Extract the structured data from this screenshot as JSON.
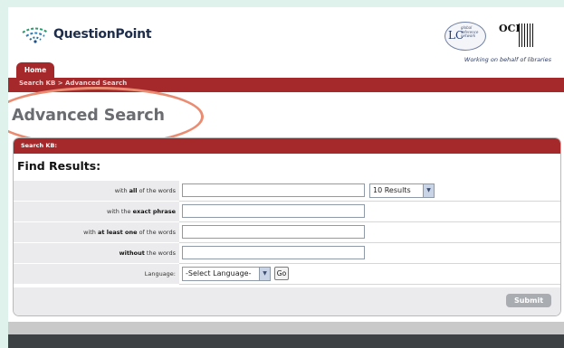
{
  "header": {
    "logo_text": "QuestionPoint",
    "lc_badge": {
      "letters": "LC",
      "sub_text": "global reference network"
    },
    "oclc_logo": "OCLC",
    "tagline": "Working on behalf of libraries"
  },
  "nav": {
    "home_tab": "Home",
    "breadcrumb": "Search KB > Advanced Search"
  },
  "page_title": "Advanced Search",
  "panel": {
    "header": "Search KB:",
    "find_results": "Find Results:",
    "rows": [
      {
        "label_pre": "with ",
        "label_bold": "all",
        "label_post": " of the words",
        "value": ""
      },
      {
        "label_pre": "with the ",
        "label_bold": "exact phrase",
        "label_post": "",
        "value": ""
      },
      {
        "label_pre": "with ",
        "label_bold": "at least one",
        "label_post": " of the words",
        "value": ""
      },
      {
        "label_pre": "",
        "label_bold": "without",
        "label_post": " the words",
        "value": ""
      }
    ],
    "results_select": "10 Results",
    "language_label": "Language:",
    "language_select": "-Select Language-",
    "go_button": "Go",
    "submit_button": "Submit"
  },
  "colors": {
    "accent_red": "#a5292a",
    "highlight": "#ea8c72",
    "page_bg": "#dff3ec",
    "footer_dark": "#3e4144"
  },
  "icons": {
    "dropdown_arrow": "chevron-down-icon",
    "logo_mark": "questionpoint-logo-icon"
  }
}
